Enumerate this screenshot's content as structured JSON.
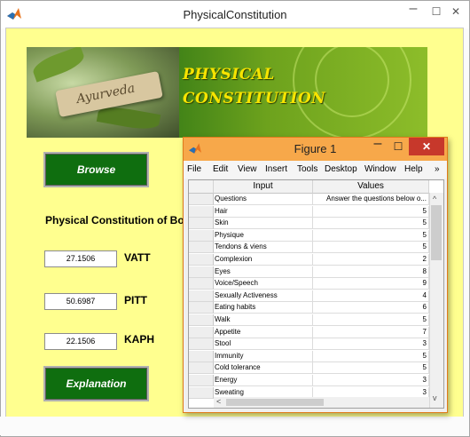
{
  "window": {
    "title": "PhysicalConstitution",
    "minimize": "–",
    "maximize": "☐",
    "close": "✕"
  },
  "banner": {
    "tag_text": "Ayurveda",
    "title_line1": "PHYSICAL",
    "title_line2": "CONSTITUTION"
  },
  "main": {
    "browse_label": "Browse",
    "result_heading": "Physical Constitution of Body is",
    "results": [
      {
        "value": "27.1506",
        "label": "VATT"
      },
      {
        "value": "50.6987",
        "label": "PITT"
      },
      {
        "value": "22.1506",
        "label": "KAPH"
      }
    ],
    "explanation_label": "Explanation"
  },
  "figure": {
    "title": "Figure 1",
    "menu": [
      "File",
      "Edit",
      "View",
      "Insert",
      "Tools",
      "Desktop",
      "Window",
      "Help",
      "»"
    ],
    "columns": [
      "Input",
      "Values"
    ],
    "rows": [
      {
        "input": "Questions",
        "value": "Answer the questions below o..."
      },
      {
        "input": "Hair",
        "value": "5"
      },
      {
        "input": "Skin",
        "value": "5"
      },
      {
        "input": "Physique",
        "value": "5"
      },
      {
        "input": "Tendons & viens",
        "value": "5"
      },
      {
        "input": "Complexion",
        "value": "2"
      },
      {
        "input": "Eyes",
        "value": "8"
      },
      {
        "input": "Voice/Speech",
        "value": "9"
      },
      {
        "input": "Sexually Activeness",
        "value": "4"
      },
      {
        "input": "Eating habits",
        "value": "6"
      },
      {
        "input": "Walk",
        "value": "5"
      },
      {
        "input": "Appetite",
        "value": "7"
      },
      {
        "input": "Stool",
        "value": "3"
      },
      {
        "input": "Immunity",
        "value": "5"
      },
      {
        "input": "Cold tolerance",
        "value": "5"
      },
      {
        "input": "Energy",
        "value": "3"
      },
      {
        "input": "Sweating",
        "value": "3"
      }
    ],
    "scroll_up": "^",
    "scroll_down": "v",
    "scroll_left": "<"
  },
  "colors": {
    "client_bg": "#ffff8f",
    "button_green": "#0f6e0f",
    "figure_title": "#f7a84a",
    "close_red": "#c7382b"
  }
}
